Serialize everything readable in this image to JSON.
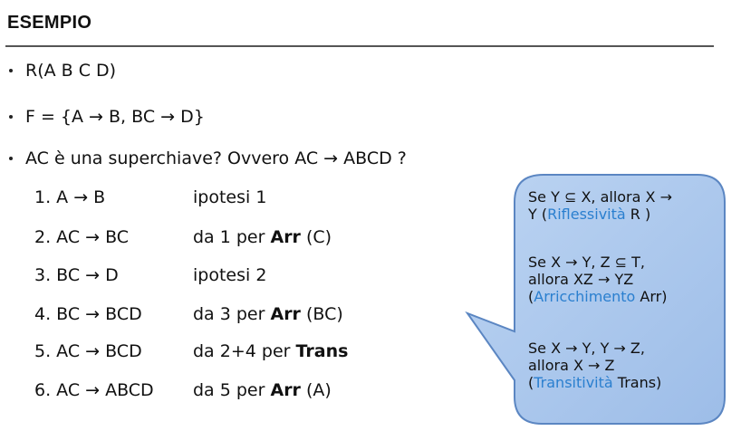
{
  "title": "ESEMPIO",
  "bullets": {
    "relation": "R(A B C D)",
    "fd_set": "F = {A → B, BC → D}",
    "question": "AC è una superchiave? Ovvero AC → ABCD ?"
  },
  "steps": [
    {
      "expr": "1. A → B",
      "just_prefix": "ipotesi 1",
      "rule": "",
      "arg": ""
    },
    {
      "expr": "2. AC → BC",
      "just_prefix": "da 1 per",
      "rule": "Arr",
      "arg": "(C)"
    },
    {
      "expr": "3. BC → D",
      "just_prefix": "ipotesi 2",
      "rule": "",
      "arg": ""
    },
    {
      "expr": "4. BC → BCD",
      "just_prefix": "da 3 per",
      "rule": "Arr",
      "arg": "(BC)"
    },
    {
      "expr": "5. AC → BCD",
      "just_prefix": "da 2+4 per",
      "rule": "Trans",
      "arg": ""
    },
    {
      "expr": "6. AC → ABCD",
      "just_prefix": "da 5 per",
      "rule": "Arr",
      "arg": "(A)"
    }
  ],
  "callout": {
    "reflexivity": {
      "line1": "Se Y ⊆ X, allora X →",
      "line2_pre": "Y (",
      "name": "Riflessività",
      "line2_post": " R )"
    },
    "augmentation": {
      "line1": "Se X → Y, Z ⊆ T,",
      "line2": "allora XZ → YZ",
      "line3_pre": "(",
      "name": "Arricchimento",
      "line3_post": "  Arr)"
    },
    "transitivity": {
      "line1": "Se X → Y, Y → Z,",
      "line2": "allora  X → Z",
      "line3_pre": "(",
      "name": "Transitività",
      "line3_post": "  Trans)"
    },
    "fill_color": "#a9c7ec",
    "border_color": "#5b86c2",
    "highlight_color": "#2a7fcf"
  }
}
